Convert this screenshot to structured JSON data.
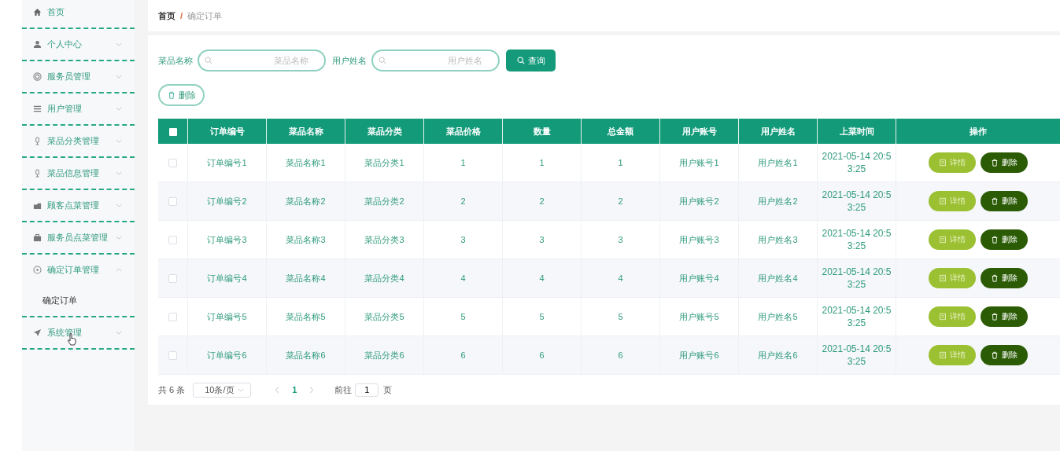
{
  "sidebar": {
    "items": [
      {
        "label": "首页",
        "kind": "link"
      },
      {
        "label": "个人中心",
        "kind": "submenu",
        "expanded": false
      },
      {
        "label": "服务员管理",
        "kind": "submenu",
        "expanded": false
      },
      {
        "label": "用户管理",
        "kind": "submenu",
        "expanded": false
      },
      {
        "label": "菜品分类管理",
        "kind": "submenu",
        "expanded": false
      },
      {
        "label": "菜品信息管理",
        "kind": "submenu",
        "expanded": false
      },
      {
        "label": "顾客点菜管理",
        "kind": "submenu",
        "expanded": false
      },
      {
        "label": "服务员点菜管理",
        "kind": "submenu",
        "expanded": false
      },
      {
        "label": "确定订单管理",
        "kind": "submenu",
        "expanded": true,
        "children": [
          {
            "label": "确定订单"
          }
        ]
      },
      {
        "label": "系统管理",
        "kind": "submenu",
        "expanded": false
      }
    ]
  },
  "breadcrumb": {
    "separator": "/",
    "items": [
      {
        "label": "首页"
      },
      {
        "label": "确定订单"
      }
    ]
  },
  "search": {
    "fields": [
      {
        "label": "菜品名称",
        "placeholder": "菜品名称"
      },
      {
        "label": "用户姓名",
        "placeholder": "用户姓名"
      }
    ],
    "button": "查询"
  },
  "delete_button": "删除",
  "table": {
    "select_all": false,
    "columns": [
      "订单编号",
      "菜品名称",
      "菜品分类",
      "菜品价格",
      "数量",
      "总金额",
      "用户账号",
      "用户姓名",
      "上菜时间",
      "操作"
    ],
    "rows": [
      {
        "selected": false,
        "cells": [
          "订单编号1",
          "菜品名称1",
          "菜品分类1",
          "1",
          "1",
          "1",
          "用户账号1",
          "用户姓名1",
          "2021-05-14 20:53:25"
        ],
        "actions": [
          "详情",
          "删除"
        ]
      },
      {
        "selected": false,
        "cells": [
          "订单编号2",
          "菜品名称2",
          "菜品分类2",
          "2",
          "2",
          "2",
          "用户账号2",
          "用户姓名2",
          "2021-05-14 20:53:25"
        ],
        "actions": [
          "详情",
          "删除"
        ]
      },
      {
        "selected": false,
        "cells": [
          "订单编号3",
          "菜品名称3",
          "菜品分类3",
          "3",
          "3",
          "3",
          "用户账号3",
          "用户姓名3",
          "2021-05-14 20:53:25"
        ],
        "actions": [
          "详情",
          "删除"
        ]
      },
      {
        "selected": false,
        "cells": [
          "订单编号4",
          "菜品名称4",
          "菜品分类4",
          "4",
          "4",
          "4",
          "用户账号4",
          "用户姓名4",
          "2021-05-14 20:53:25"
        ],
        "actions": [
          "详情",
          "删除"
        ]
      },
      {
        "selected": false,
        "cells": [
          "订单编号5",
          "菜品名称5",
          "菜品分类5",
          "5",
          "5",
          "5",
          "用户账号5",
          "用户姓名5",
          "2021-05-14 20:53:25"
        ],
        "actions": [
          "详情",
          "删除"
        ]
      },
      {
        "selected": false,
        "cells": [
          "订单编号6",
          "菜品名称6",
          "菜品分类6",
          "6",
          "6",
          "6",
          "用户账号6",
          "用户姓名6",
          "2021-05-14 20:53:25"
        ],
        "actions": [
          "详情",
          "删除"
        ]
      }
    ]
  },
  "pagination": {
    "total": "共 6 条",
    "page_size": "10条/页",
    "pages": [
      {
        "label": "1",
        "selected": true
      }
    ],
    "goto_label": "前往",
    "goto_value": "1",
    "goto_suffix": "页"
  }
}
